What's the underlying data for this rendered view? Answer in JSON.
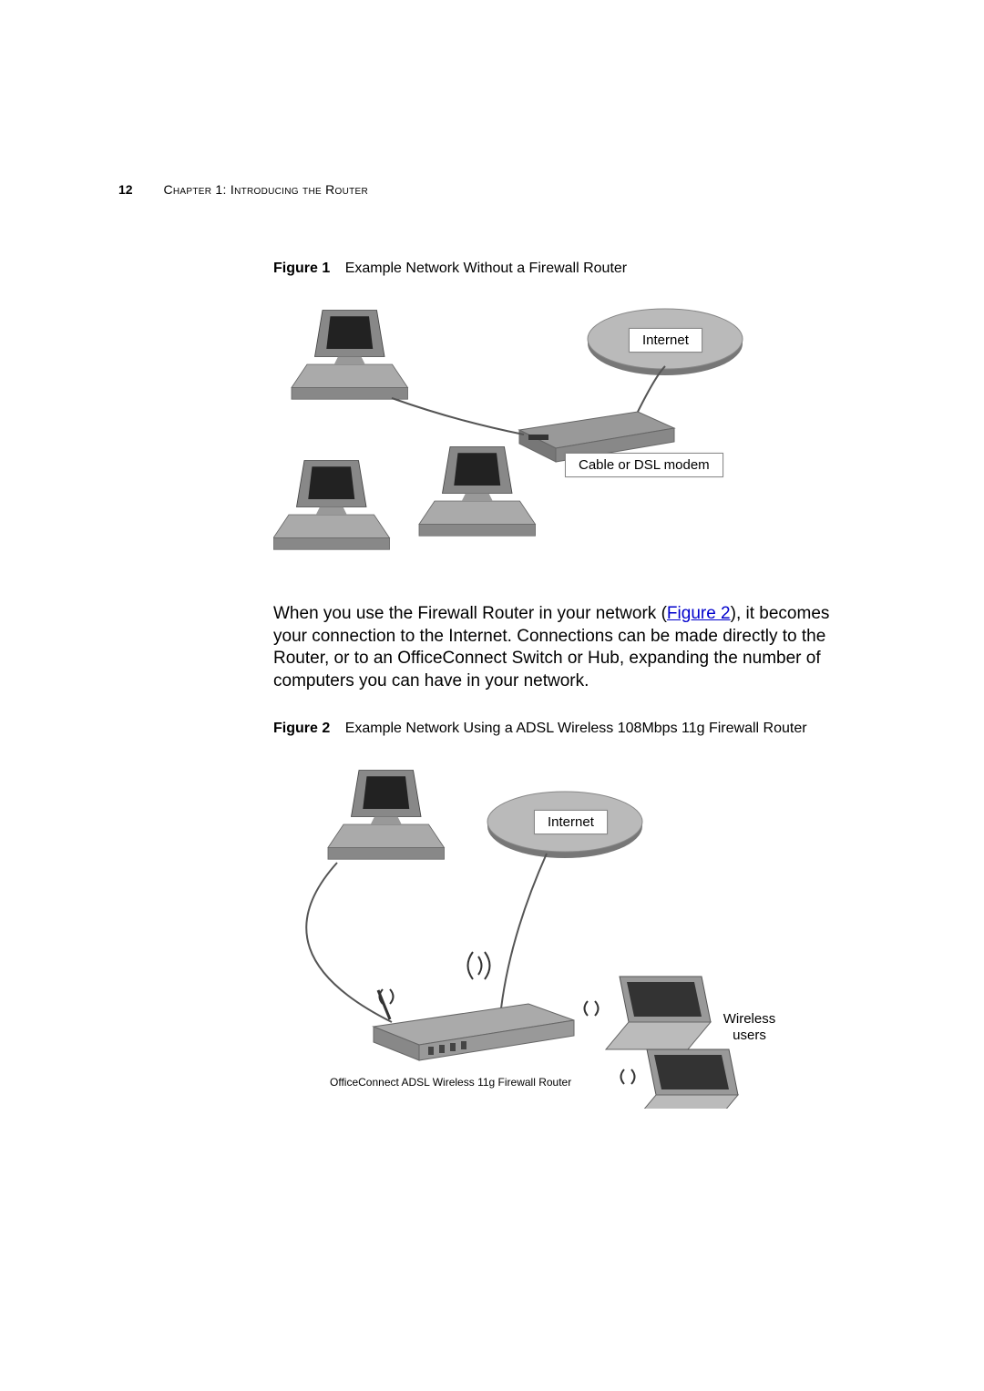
{
  "header": {
    "page_number": "12",
    "chapter": "Chapter 1: Introducing the Router"
  },
  "figure1": {
    "label": "Figure 1",
    "caption": "Example Network Without a Firewall Router",
    "labels": {
      "internet": "Internet",
      "modem": "Cable or DSL modem"
    }
  },
  "paragraph": {
    "text_before_link": "When you use the Firewall Router in your network (",
    "link_text": "Figure 2",
    "text_after_link": "), it becomes your connection to the Internet. Connections can be made directly to the Router, or to an OfficeConnect Switch or Hub, expanding the number of computers you can have in your network."
  },
  "figure2": {
    "label": "Figure 2",
    "caption": "Example Network Using a ADSL Wireless 108Mbps 11g Firewall Router",
    "labels": {
      "internet": "Internet",
      "wireless": "Wireless users",
      "router": "OfficeConnect ADSL Wireless 11g Firewall Router"
    }
  }
}
